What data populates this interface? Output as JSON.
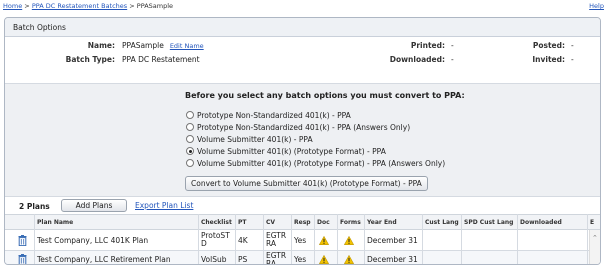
{
  "breadcrumb": {
    "home": "Home",
    "sep": ">",
    "batches": "PPA DC Restatement Batches",
    "current": "PPASample"
  },
  "help": "Help",
  "section_title": "Batch Options",
  "batch": {
    "name_label": "Name:",
    "name_value": "PPASample",
    "edit_name": "Edit Name",
    "type_label": "Batch Type:",
    "type_value": "PPA DC Restatement",
    "printed_label": "Printed:",
    "printed_value": "-",
    "downloaded_label": "Downloaded:",
    "downloaded_value": "-",
    "posted_label": "Posted:",
    "posted_value": "-",
    "invited_label": "Invited:",
    "invited_value": "-"
  },
  "convert": {
    "heading": "Before you select any batch options you must convert to PPA:",
    "options": [
      {
        "label": "Prototype Non-Standardized 401(k) - PPA",
        "selected": false
      },
      {
        "label": "Prototype Non-Standardized 401(k) - PPA (Answers Only)",
        "selected": false
      },
      {
        "label": "Volume Submitter 401(k) - PPA",
        "selected": false
      },
      {
        "label": "Volume Submitter 401(k) (Prototype Format) - PPA",
        "selected": true
      },
      {
        "label": "Volume Submitter 401(k) (Prototype Format) - PPA (Answers Only)",
        "selected": false
      }
    ],
    "button": "Convert to Volume Submitter 401(k) (Prototype Format) - PPA"
  },
  "plans": {
    "count_label": "2 Plans",
    "add_button": "Add Plans",
    "export_link": "Export Plan List",
    "columns": [
      "Plan Name",
      "Checklist",
      "PT",
      "CV",
      "Resp",
      "Doc",
      "Forms",
      "Year End",
      "Cust Lang",
      "SPD Cust Lang",
      "Downloaded",
      "E"
    ],
    "rows": [
      {
        "name": "Test Company, LLC 401K Plan",
        "checklist": "ProtoST D",
        "pt": "4K",
        "cv": "EGTR RA",
        "resp": "Yes",
        "year_end": "December 31"
      },
      {
        "name": "Test Company, LLC Retirement Plan",
        "checklist": "VolSub",
        "pt": "PS",
        "cv": "EGTR RA",
        "resp": "Yes",
        "year_end": "December 31"
      }
    ]
  },
  "colors": {
    "link": "#2255bb",
    "header_bg": "#eef1f5",
    "warning": "#f2c200"
  }
}
